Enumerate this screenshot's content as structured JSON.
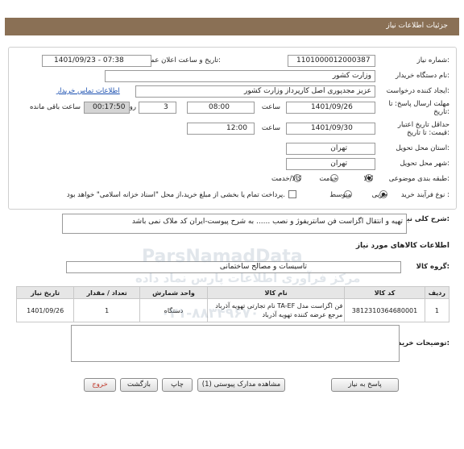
{
  "title": "جزئیات اطلاعات نیاز",
  "fields": {
    "need_number_label": "شماره نیاز:",
    "need_number": "1101000012000387",
    "announce_label": "تاریخ و ساعت اعلان عمومی:",
    "announce_value": "1401/09/23 - 07:38",
    "buyer_org_label": "نام دستگاه خریدار:",
    "buyer_org": "وزارت کشور",
    "creator_label": "ایجاد کننده درخواست:",
    "creator": "عزیز مجدپوری اصل کارپرداز وزارت کشور",
    "contact_link": "اطلاعات تماس خریدار",
    "deadline_label": "مهلت ارسال پاسخ: تا تاریخ:",
    "deadline_date": "1401/09/26",
    "time_label": "ساعت",
    "deadline_time": "08:00",
    "days_value": "3",
    "days_label": "روز و",
    "remaining_time": "00:17:50",
    "remaining_label": "ساعت باقی مانده",
    "validity_label": "حداقل تاریخ اعتبار قیمت: تا تاریخ:",
    "validity_date": "1401/09/30",
    "validity_time": "12:00",
    "province_label": "استان محل تحویل:",
    "province": "تهران",
    "city_label": "شهر محل تحویل:",
    "city": "تهران",
    "category_label": "طبقه بندی موضوعی:",
    "category_options": [
      "کالا",
      "خدمت",
      "کالا/خدمت"
    ],
    "process_label": "نوع فرآیند خرید :",
    "process_options": [
      "جزیی",
      "متوسط"
    ],
    "payment_note": "پرداخت تمام یا بخشی از مبلغ خرید،از محل \"اسناد خزانه اسلامی\" خواهد بود."
  },
  "description": {
    "label": "شرح کلی نیاز:",
    "text": "تهیه و انتقال اگزاست فن سانتریفوژ و نصب ...... به شرح پیوست-ایران کد ملاک نمی باشد"
  },
  "goods_section_title": "اطلاعات کالاهای مورد نیاز",
  "goods_group_label": "گروه کالا:",
  "goods_group": "تاسیسات و مصالح ساختمانی",
  "table": {
    "headers": [
      "ردیف",
      "کد کالا",
      "نام کالا",
      "واحد شمارش",
      "تعداد / مقدار",
      "تاریخ نیاز"
    ],
    "rows": [
      [
        "1",
        "3812310364680001",
        "فن اگزاست مدل TA-EF نام تجارتی تهویه آذرباد مرجع عرضه کننده تهویه آذرباد",
        "دستگاه",
        "1",
        "1401/09/26"
      ]
    ]
  },
  "buyer_notes_label": "توضیحات خریدار:",
  "buttons": {
    "reply": "پاسخ به نیاز",
    "docs": "مشاهده مدارک پیوستی (1)",
    "print": "چاپ",
    "back": "بازگشت",
    "exit": "خروج"
  },
  "watermark": {
    "brand": "ParsNamadData",
    "line1": "مرکز فرآوری اطلاعات پارس نماد داده",
    "line2": "۰۲۱-۸۸۳۴۹۶۷۰"
  },
  "colors": {
    "title_bar": "#8a7055",
    "remaining_box": "#d4d4d4",
    "exit_text": "#c0392b",
    "link": "#1a4fb0"
  }
}
